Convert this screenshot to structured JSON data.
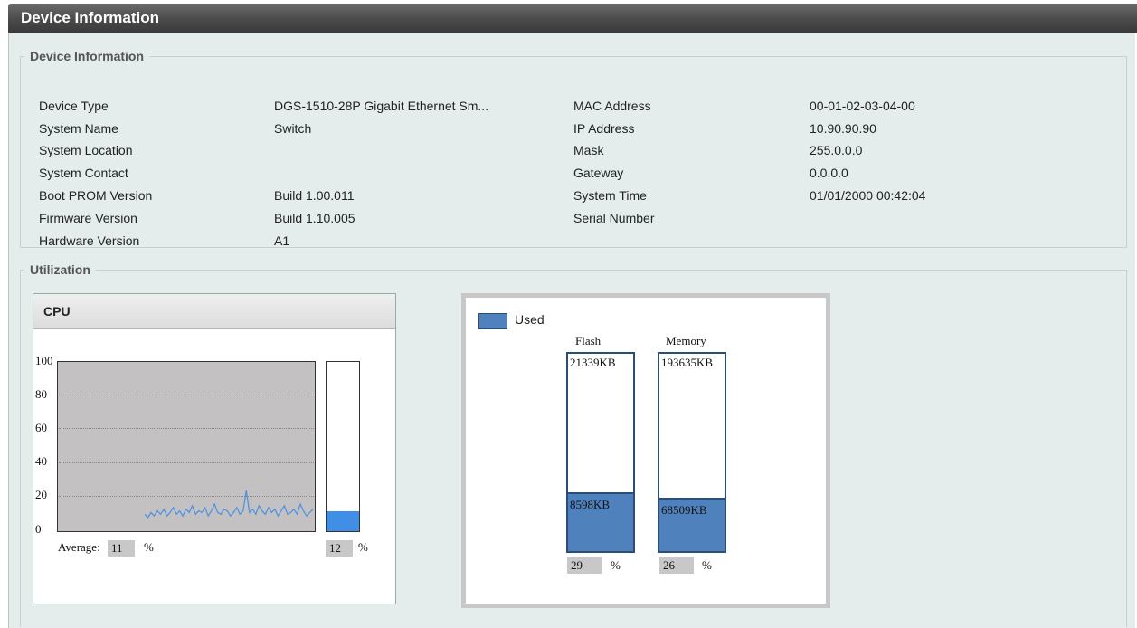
{
  "page": {
    "title": "Device Information"
  },
  "info": {
    "legend": "Device Information",
    "left": [
      {
        "label": "Device Type",
        "value": "DGS-1510-28P Gigabit Ethernet Sm..."
      },
      {
        "label": "System Name",
        "value": "Switch"
      },
      {
        "label": "System Location",
        "value": ""
      },
      {
        "label": "System Contact",
        "value": ""
      },
      {
        "label": "Boot PROM Version",
        "value": "Build 1.00.011"
      },
      {
        "label": "Firmware Version",
        "value": "Build 1.10.005"
      },
      {
        "label": "Hardware Version",
        "value": "A1"
      }
    ],
    "right": [
      {
        "label": "MAC Address",
        "value": "00-01-02-03-04-00"
      },
      {
        "label": "IP Address",
        "value": "10.90.90.90"
      },
      {
        "label": "Mask",
        "value": "255.0.0.0"
      },
      {
        "label": "Gateway",
        "value": "0.0.0.0"
      },
      {
        "label": "System Time",
        "value": "01/01/2000 00:42:04"
      },
      {
        "label": "Serial Number",
        "value": ""
      }
    ]
  },
  "utilization": {
    "legend": "Utilization",
    "cpu": {
      "title": "CPU",
      "y_ticks": [
        "100",
        "80",
        "60",
        "40",
        "20",
        "0"
      ],
      "history": [
        10,
        8,
        11,
        9,
        12,
        10,
        13,
        9,
        11,
        14,
        10,
        12,
        9,
        13,
        11,
        15,
        10,
        12,
        11,
        14,
        9,
        12,
        16,
        11,
        10,
        13,
        12,
        9,
        11,
        14,
        10,
        12,
        24,
        11,
        13,
        10,
        15,
        12,
        10,
        14,
        11,
        13,
        9,
        12,
        15,
        10,
        11,
        13,
        10,
        16,
        12,
        9,
        11,
        13
      ],
      "average_label": "Average:",
      "average_value": "11",
      "current_value": "12",
      "percent_unit": "%"
    },
    "memory": {
      "legend_used": "Used",
      "columns": [
        {
          "name": "Flash",
          "total": "21339KB",
          "used": "8598KB",
          "percent": "29",
          "unit": "%"
        },
        {
          "name": "Memory",
          "total": "193635KB",
          "used": "68509KB",
          "percent": "26",
          "unit": "%"
        }
      ]
    }
  },
  "colors": {
    "cpu_line": "#4a90e2",
    "cpu_bar": "#3f8ee8",
    "used": "#4f81bd"
  }
}
